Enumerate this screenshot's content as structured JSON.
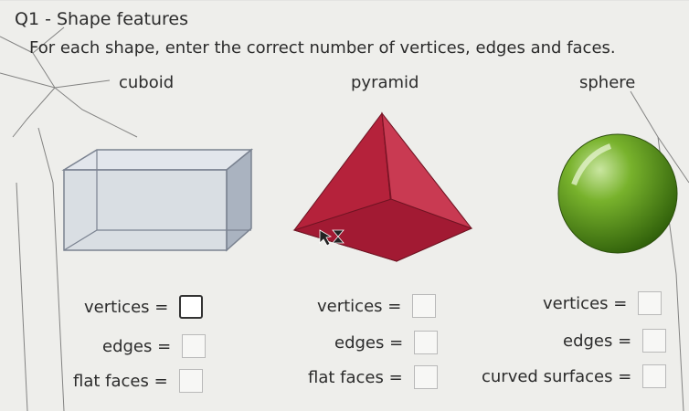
{
  "question": {
    "title": "Q1 - Shape features",
    "instruction": "For each shape, enter the correct number of vertices, edges and faces."
  },
  "shapes": {
    "cuboid": {
      "name": "cuboid",
      "vertices_label": "vertices =",
      "edges_label": "edges =",
      "faces_label": "flat faces ="
    },
    "pyramid": {
      "name": "pyramid",
      "vertices_label": "vertices =",
      "edges_label": "edges =",
      "faces_label": "flat faces ="
    },
    "sphere": {
      "name": "sphere",
      "vertices_label": "vertices =",
      "edges_label": "edges =",
      "faces_label": "curved surfaces ="
    }
  },
  "inputs": {
    "cuboid": {
      "vertices": "",
      "edges": "",
      "faces": ""
    },
    "pyramid": {
      "vertices": "",
      "edges": "",
      "faces": ""
    },
    "sphere": {
      "vertices": "",
      "edges": "",
      "faces": ""
    }
  },
  "colors": {
    "cuboid": "#c9d2dd",
    "pyramid": "#b5223b",
    "sphere": "#5f9a1c",
    "background": "#eeeeeb"
  },
  "icons": {
    "cursor": "busy-cursor-icon"
  }
}
